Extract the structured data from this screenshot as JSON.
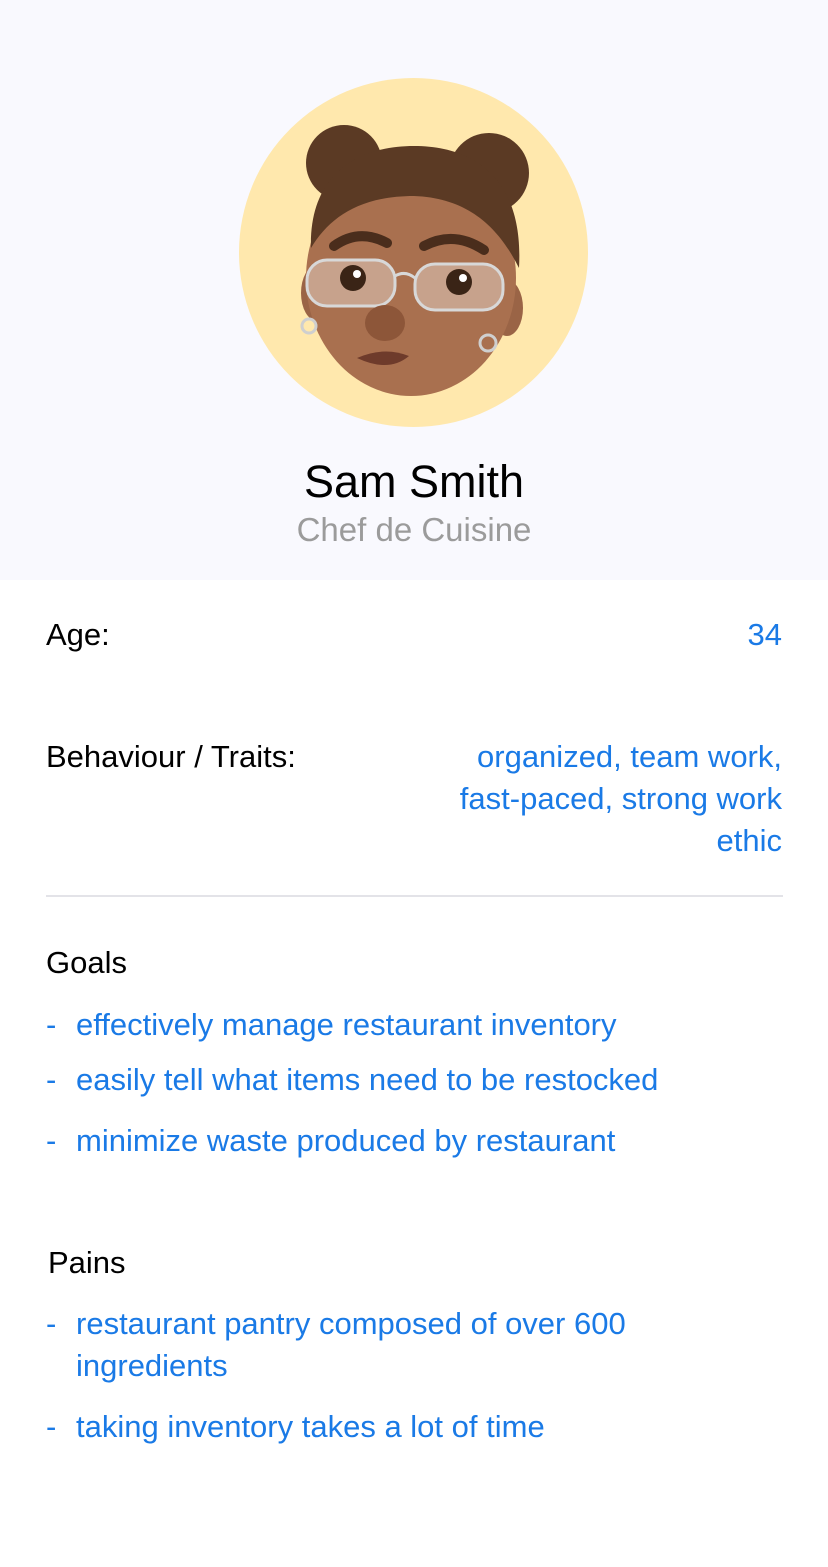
{
  "profile": {
    "name": "Sam Smith",
    "role": "Chef de Cuisine"
  },
  "details": {
    "age_label": "Age:",
    "age_value": "34",
    "traits_label": "Behaviour / Traits:",
    "traits_lines": [
      "organized, team work,",
      "fast-paced, strong work",
      "ethic"
    ]
  },
  "goals": {
    "title": "Goals",
    "items": [
      "effectively manage restaurant inventory",
      "easily tell what items need to be restocked",
      "minimize waste produced by restaurant"
    ]
  },
  "pains": {
    "title": "Pains",
    "items": [
      [
        "restaurant pantry composed of over 600",
        "ingredients"
      ],
      [
        "taking inventory takes a lot of time"
      ]
    ]
  },
  "bullet_marker": "-",
  "colors": {
    "accent": "#1a7ae6",
    "header_bg": "#f9f9fe",
    "avatar_bg": "#ffe8ad",
    "subtitle": "#9b9b9b"
  },
  "icons": {
    "avatar": "memoji-avatar-icon"
  }
}
